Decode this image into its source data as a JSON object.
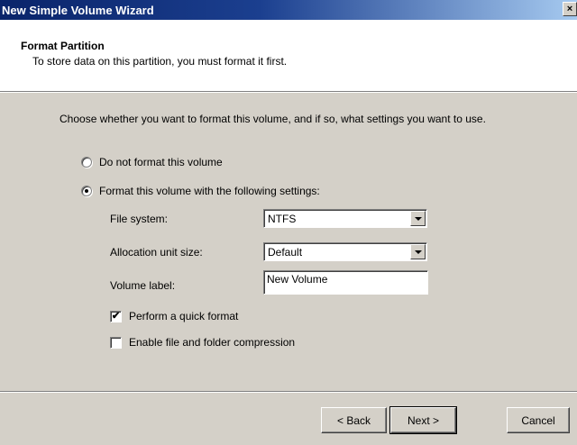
{
  "window": {
    "title": "New Simple Volume Wizard",
    "close_glyph": "×"
  },
  "header": {
    "title": "Format Partition",
    "subtitle": "To store data on this partition, you must format it first."
  },
  "instructions": "Choose whether you want to format this volume, and if so, what settings you want to use.",
  "options": {
    "no_format": {
      "label": "Do not format this volume",
      "selected": false
    },
    "format": {
      "label": "Format this volume with the following settings:",
      "selected": true
    }
  },
  "fields": {
    "file_system": {
      "label": "File system:",
      "value": "NTFS"
    },
    "allocation_unit": {
      "label": "Allocation unit size:",
      "value": "Default"
    },
    "volume_label": {
      "label": "Volume label:",
      "value": "New Volume"
    }
  },
  "checkboxes": {
    "quick_format": {
      "label": "Perform a quick format",
      "checked": true,
      "mark": "✔"
    },
    "compression": {
      "label": "Enable file and folder compression",
      "checked": false
    }
  },
  "buttons": {
    "back": "< Back",
    "next": "Next >",
    "cancel": "Cancel"
  }
}
